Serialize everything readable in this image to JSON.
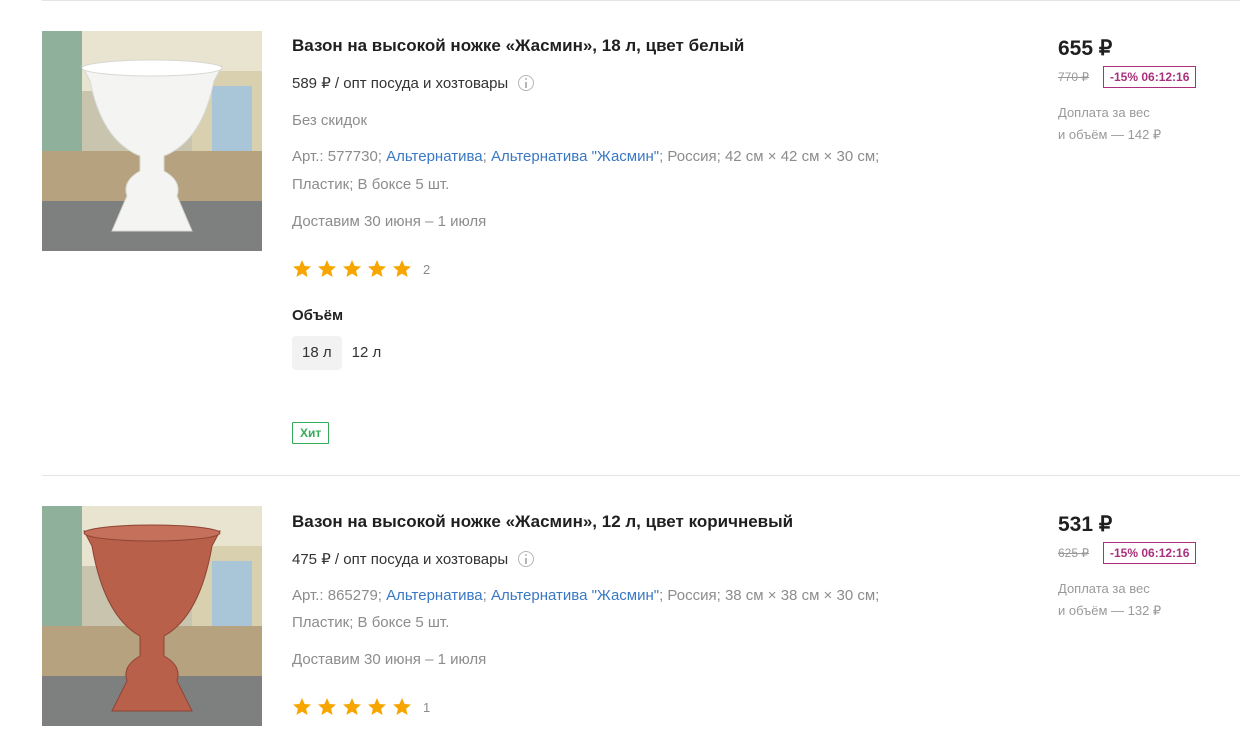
{
  "products": [
    {
      "title": "Вазон на высокой ножке «Жасмин», 18 л, цвет белый",
      "opt_price": "589 ₽ / опт посуда и хозтовары",
      "no_discount": "Без скидок",
      "art_prefix": "Арт.: 577730;",
      "brand": "Альтернатива",
      "series": "Альтернатива \"Жасмин\"",
      "specs_line1": "; Россия; 42 см × 42 см × 30 см;",
      "specs_line2": "Пластик; В боксе 5 шт.",
      "delivery": "Доставим 30 июня – 1 июля",
      "rating": 5,
      "review_count": "2",
      "volume_title": "Объём",
      "volumes": [
        "18 л",
        "12 л"
      ],
      "selected_volume": "18 л",
      "badge": "Хит",
      "price": "655 ₽",
      "old_price": "770 ₽",
      "discount": "-15% 06:12:16",
      "surcharge_line1": "Доплата за вес",
      "surcharge_line2": "и объём — 142 ₽",
      "vase_color": "#f4f4f2"
    },
    {
      "title": "Вазон на высокой ножке «Жасмин», 12 л, цвет коричневый",
      "opt_price": "475 ₽ / опт посуда и хозтовары",
      "art_prefix": "Арт.: 865279;",
      "brand": "Альтернатива",
      "series": "Альтернатива \"Жасмин\"",
      "specs_line1": "; Россия; 38 см × 38 см × 30 см;",
      "specs_line2": "Пластик; В боксе 5 шт.",
      "delivery": "Доставим 30 июня – 1 июля",
      "rating": 5,
      "review_count": "1",
      "price": "531 ₽",
      "old_price": "625 ₽",
      "discount": "-15% 06:12:16",
      "surcharge_line1": "Доплата за вес",
      "surcharge_line2": "и объём — 132 ₽",
      "vase_color": "#b9604b"
    }
  ]
}
